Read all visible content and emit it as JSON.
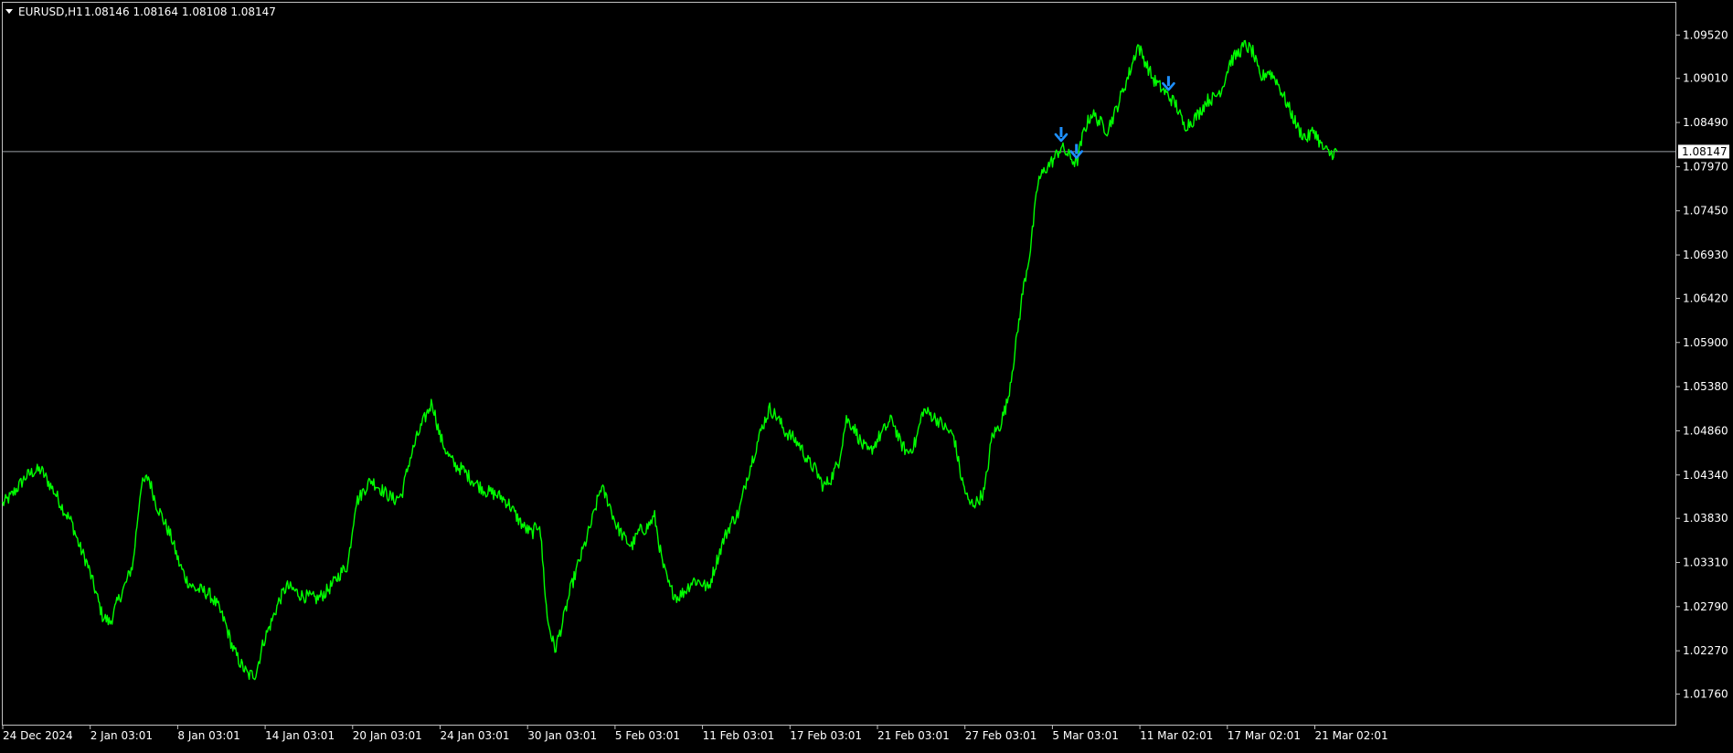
{
  "header": {
    "symbol": "EURUSD,H1",
    "ohlc": "1.08146 1.08164 1.08108 1.08147"
  },
  "colors": {
    "background": "#000000",
    "frame": "#c0c0c0",
    "price_line": "#00ff00",
    "arrow": "#1e90ff",
    "text": "#ffffff",
    "current_line": "#9aa0a6"
  },
  "chart_data": {
    "type": "line",
    "title": "EURUSD,H1",
    "current_price": 1.08147,
    "current_price_label": "1.08147",
    "ylim": [
      1.014,
      1.099
    ],
    "y_ticks": [
      "1.09520",
      "1.09010",
      "1.08490",
      "1.07970",
      "1.07450",
      "1.06930",
      "1.06420",
      "1.05900",
      "1.05380",
      "1.04860",
      "1.04340",
      "1.03830",
      "1.03310",
      "1.02790",
      "1.02270",
      "1.01760"
    ],
    "x_ticks": [
      "24 Dec 2024",
      "2 Jan 03:01",
      "8 Jan 03:01",
      "14 Jan 03:01",
      "20 Jan 03:01",
      "24 Jan 03:01",
      "30 Jan 03:01",
      "5 Feb 03:01",
      "11 Feb 03:01",
      "17 Feb 03:01",
      "21 Feb 03:01",
      "27 Feb 03:01",
      "5 Mar 03:01",
      "11 Mar 02:01",
      "17 Mar 02:01",
      "21 Mar 02:01"
    ],
    "series": [
      {
        "values": [
          1.04,
          1.0408,
          1.042,
          1.0432,
          1.0438,
          1.044,
          1.0425,
          1.041,
          1.0392,
          1.0378,
          1.035,
          1.033,
          1.03,
          1.0268,
          1.026,
          1.0285,
          1.0305,
          1.033,
          1.042,
          1.0432,
          1.04,
          1.038,
          1.036,
          1.033,
          1.031,
          1.03,
          1.0298,
          1.0293,
          1.028,
          1.026,
          1.023,
          1.0212,
          1.0198,
          1.02,
          1.0238,
          1.026,
          1.0285,
          1.0303,
          1.0298,
          1.0292,
          1.029,
          1.0288,
          1.0295,
          1.0305,
          1.0318,
          1.0328,
          1.04,
          1.0415,
          1.0428,
          1.042,
          1.0412,
          1.0405,
          1.041,
          1.045,
          1.0478,
          1.05,
          1.052,
          1.048,
          1.0458,
          1.0445,
          1.044,
          1.043,
          1.0422,
          1.0415,
          1.0412,
          1.0408,
          1.04,
          1.0385,
          1.0372,
          1.0365,
          1.0378,
          1.0265,
          1.0228,
          1.026,
          1.0298,
          1.0328,
          1.0355,
          1.0385,
          1.042,
          1.0402,
          1.0375,
          1.036,
          1.035,
          1.0368,
          1.0372,
          1.0385,
          1.033,
          1.03,
          1.029,
          1.0298,
          1.031,
          1.0308,
          1.03,
          1.033,
          1.0358,
          1.0378,
          1.039,
          1.043,
          1.046,
          1.049,
          1.0512,
          1.0502,
          1.0485,
          1.0478,
          1.0468,
          1.045,
          1.044,
          1.042,
          1.043,
          1.045,
          1.05,
          1.049,
          1.047,
          1.046,
          1.0475,
          1.0488,
          1.05,
          1.0472,
          1.046,
          1.0472,
          1.051,
          1.0505,
          1.0498,
          1.0488,
          1.048,
          1.043,
          1.04,
          1.0402,
          1.0415,
          1.048,
          1.0492,
          1.052,
          1.058,
          1.065,
          1.07,
          1.078,
          1.0795,
          1.0805,
          1.082,
          1.081,
          1.08,
          1.084,
          1.086,
          1.085,
          1.084,
          1.086,
          1.0885,
          1.091,
          1.094,
          1.092,
          1.09,
          1.089,
          1.088,
          1.087,
          1.0845,
          1.085,
          1.086,
          1.0875,
          1.0878,
          1.089,
          1.092,
          1.093,
          1.094,
          1.0932,
          1.09,
          1.091,
          1.09,
          1.088,
          1.086,
          1.084,
          1.083,
          1.084,
          1.082,
          1.0812,
          1.0815
        ]
      }
    ],
    "annotations": [
      {
        "type": "down-arrow",
        "index": 138
      },
      {
        "type": "down-arrow",
        "index": 140
      },
      {
        "type": "down-arrow",
        "index": 152
      }
    ],
    "xlabel": "",
    "ylabel": "",
    "grid": false,
    "legend": "none"
  }
}
